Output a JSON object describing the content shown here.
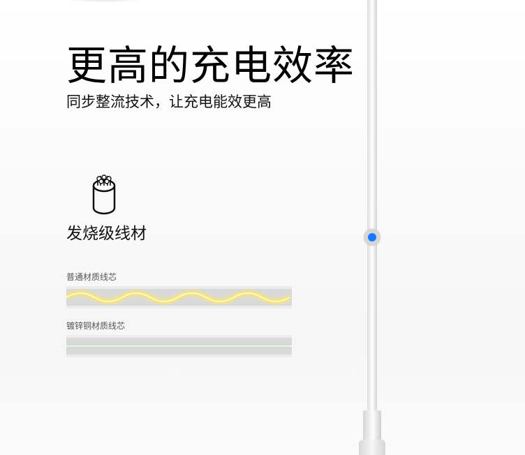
{
  "hero": {
    "title": "更高的充电效率",
    "subtitle": "同步整流技术，让充电能效更高"
  },
  "feature": {
    "icon": "wire-bundle-icon",
    "label": "发烧级线材"
  },
  "comparison": [
    {
      "label": "普通材质线芯",
      "glow_color": "#ffe95a"
    },
    {
      "label": "镀锌铜材质线芯",
      "glow_color": "#6ee86e"
    }
  ],
  "slider": {
    "accent": "#1677ff",
    "position_percent": 52
  }
}
